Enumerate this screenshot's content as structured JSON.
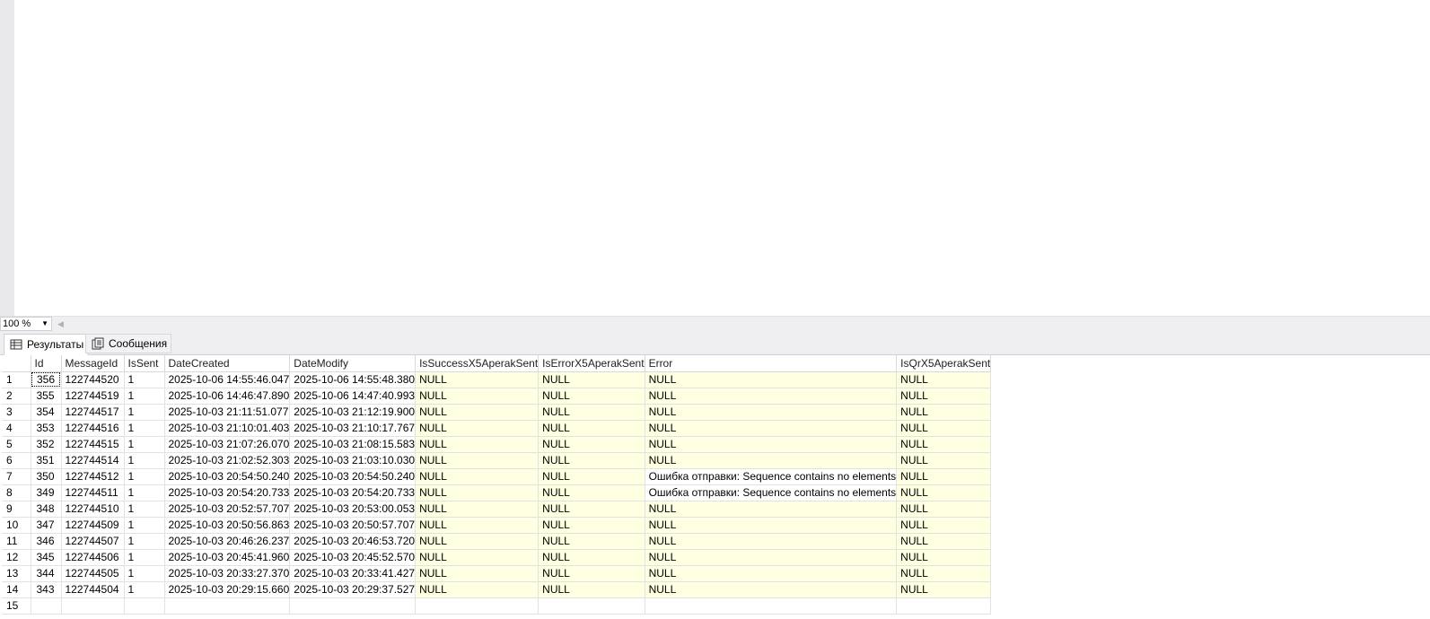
{
  "status_bar": {
    "zoom": "100 %"
  },
  "tabs": [
    {
      "label": "Результаты",
      "icon": "grid-icon",
      "active": true
    },
    {
      "label": "Сообщения",
      "icon": "messages-icon",
      "active": false
    }
  ],
  "colors": {
    "null_cell_bg": "#ffffe1",
    "grid_line": "#e2e2e2",
    "chrome_bg": "#efeff2"
  },
  "results": {
    "columns": [
      "Id",
      "MessageId",
      "IsSent",
      "DateCreated",
      "DateModify",
      "IsSuccessX5AperakSent",
      "IsErrorX5AperakSent",
      "Error",
      "IsQrX5AperakSent"
    ],
    "rows": [
      {
        "n": "1",
        "cells": [
          "356",
          "122744520",
          "1",
          "2025-10-06 14:55:46.047",
          "2025-10-06 14:55:48.380",
          "NULL",
          "NULL",
          "NULL",
          "NULL"
        ]
      },
      {
        "n": "2",
        "cells": [
          "355",
          "122744519",
          "1",
          "2025-10-06 14:46:47.890",
          "2025-10-06 14:47:40.993",
          "NULL",
          "NULL",
          "NULL",
          "NULL"
        ]
      },
      {
        "n": "3",
        "cells": [
          "354",
          "122744517",
          "1",
          "2025-10-03 21:11:51.077",
          "2025-10-03 21:12:19.900",
          "NULL",
          "NULL",
          "NULL",
          "NULL"
        ]
      },
      {
        "n": "4",
        "cells": [
          "353",
          "122744516",
          "1",
          "2025-10-03 21:10:01.403",
          "2025-10-03 21:10:17.767",
          "NULL",
          "NULL",
          "NULL",
          "NULL"
        ]
      },
      {
        "n": "5",
        "cells": [
          "352",
          "122744515",
          "1",
          "2025-10-03 21:07:26.070",
          "2025-10-03 21:08:15.583",
          "NULL",
          "NULL",
          "NULL",
          "NULL"
        ]
      },
      {
        "n": "6",
        "cells": [
          "351",
          "122744514",
          "1",
          "2025-10-03 21:02:52.303",
          "2025-10-03 21:03:10.030",
          "NULL",
          "NULL",
          "NULL",
          "NULL"
        ]
      },
      {
        "n": "7",
        "cells": [
          "350",
          "122744512",
          "1",
          "2025-10-03 20:54:50.240",
          "2025-10-03 20:54:50.240",
          "NULL",
          "NULL",
          "Ошибка отправки: Sequence contains no elements",
          "NULL"
        ]
      },
      {
        "n": "8",
        "cells": [
          "349",
          "122744511",
          "1",
          "2025-10-03 20:54:20.733",
          "2025-10-03 20:54:20.733",
          "NULL",
          "NULL",
          "Ошибка отправки: Sequence contains no elements",
          "NULL"
        ]
      },
      {
        "n": "9",
        "cells": [
          "348",
          "122744510",
          "1",
          "2025-10-03 20:52:57.707",
          "2025-10-03 20:53:00.053",
          "NULL",
          "NULL",
          "NULL",
          "NULL"
        ]
      },
      {
        "n": "10",
        "cells": [
          "347",
          "122744509",
          "1",
          "2025-10-03 20:50:56.863",
          "2025-10-03 20:50:57.707",
          "NULL",
          "NULL",
          "NULL",
          "NULL"
        ]
      },
      {
        "n": "11",
        "cells": [
          "346",
          "122744507",
          "1",
          "2025-10-03 20:46:26.237",
          "2025-10-03 20:46:53.720",
          "NULL",
          "NULL",
          "NULL",
          "NULL"
        ]
      },
      {
        "n": "12",
        "cells": [
          "345",
          "122744506",
          "1",
          "2025-10-03 20:45:41.960",
          "2025-10-03 20:45:52.570",
          "NULL",
          "NULL",
          "NULL",
          "NULL"
        ]
      },
      {
        "n": "13",
        "cells": [
          "344",
          "122744505",
          "1",
          "2025-10-03 20:33:27.370",
          "2025-10-03 20:33:41.427",
          "NULL",
          "NULL",
          "NULL",
          "NULL"
        ]
      },
      {
        "n": "14",
        "cells": [
          "343",
          "122744504",
          "1",
          "2025-10-03 20:29:15.660",
          "2025-10-03 20:29:37.527",
          "NULL",
          "NULL",
          "NULL",
          "NULL"
        ]
      },
      {
        "n": "15",
        "cells": [
          "",
          "",
          "",
          "",
          "",
          "",
          "",
          "",
          ""
        ]
      }
    ]
  }
}
